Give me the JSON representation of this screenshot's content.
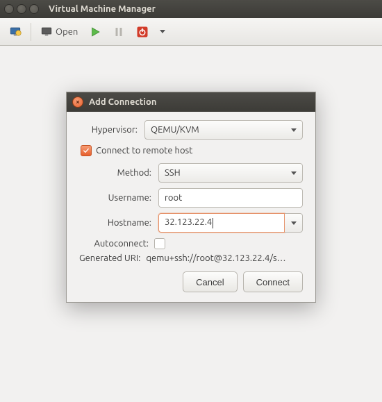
{
  "mainWindow": {
    "title": "Virtual Machine Manager",
    "toolbar": {
      "open_label": "Open"
    }
  },
  "dialog": {
    "title": "Add Connection",
    "labels": {
      "hypervisor": "Hypervisor:",
      "remote_checkbox": "Connect to remote host",
      "method": "Method:",
      "username": "Username:",
      "hostname": "Hostname:",
      "autoconnect": "Autoconnect:",
      "generated_uri": "Generated URI:"
    },
    "values": {
      "hypervisor": "QEMU/KVM",
      "method": "SSH",
      "username": "root",
      "hostname": "32.123.22.4",
      "remote_checked": true,
      "autoconnect_checked": false,
      "generated_uri": "qemu+ssh://root@32.123.22.4/s…"
    },
    "buttons": {
      "cancel": "Cancel",
      "connect": "Connect"
    }
  }
}
